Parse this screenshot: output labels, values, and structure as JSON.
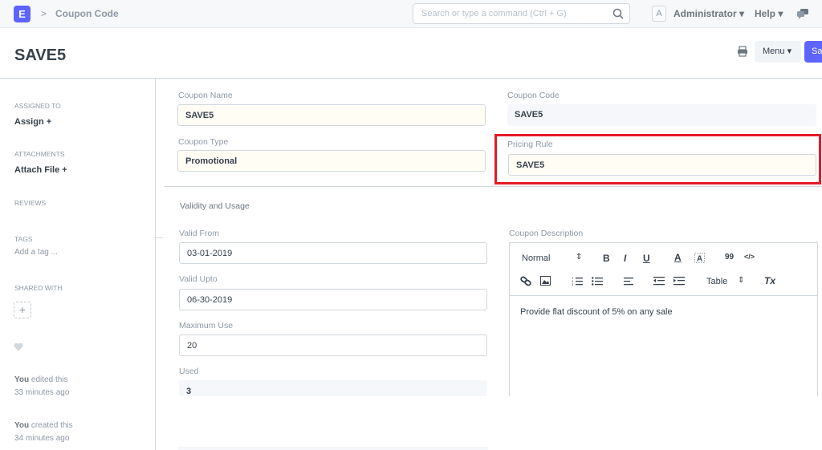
{
  "navbar": {
    "logo_letter": "E",
    "breadcrumb": "Coupon Code",
    "search_placeholder": "Search or type a command (Ctrl + G)",
    "avatar_letter": "A",
    "user": "Administrator",
    "help": "Help"
  },
  "page": {
    "title": "SAVE5",
    "menu_label": "Menu",
    "save_label": "Save",
    "accent_color": "#5e64ff"
  },
  "sidebar": {
    "assigned_to_label": "ASSIGNED TO",
    "assign_text": "Assign +",
    "attachments_label": "ATTACHMENTS",
    "attach_text": "Attach File +",
    "reviews_label": "REVIEWS",
    "tags_label": "TAGS",
    "add_tag": "Add a tag ...",
    "shared_with_label": "SHARED WITH",
    "share_add": "+",
    "activity": [
      {
        "who": "You",
        "what": " edited this",
        "when": "33 minutes ago"
      },
      {
        "who": "You",
        "what": " created this",
        "when": "34 minutes ago"
      }
    ]
  },
  "form": {
    "coupon_name_label": "Coupon Name",
    "coupon_name": "SAVE5",
    "coupon_code_label": "Coupon Code",
    "coupon_code": "SAVE5",
    "coupon_type_label": "Coupon Type",
    "coupon_type": "Promotional",
    "pricing_rule_label": "Pricing Rule",
    "pricing_rule": "SAVE5",
    "section_title": "Validity and Usage",
    "valid_from_label": "Valid From",
    "valid_from": "03-01-2019",
    "valid_upto_label": "Valid Upto",
    "valid_upto": "06-30-2019",
    "maximum_use_label": "Maximum Use",
    "maximum_use": "20",
    "used_label": "Used",
    "used": "3",
    "description_label": "Coupon Description",
    "description": "Provide flat discount of 5% on any sale"
  },
  "editor_toolbar": {
    "format": "Normal",
    "table": "Table",
    "bold": "B",
    "italic": "I",
    "underline": "U",
    "font_color": "A",
    "blockquote": "99",
    "code": "</>",
    "clear": "Tx"
  },
  "highlight_color": "#e51a23"
}
